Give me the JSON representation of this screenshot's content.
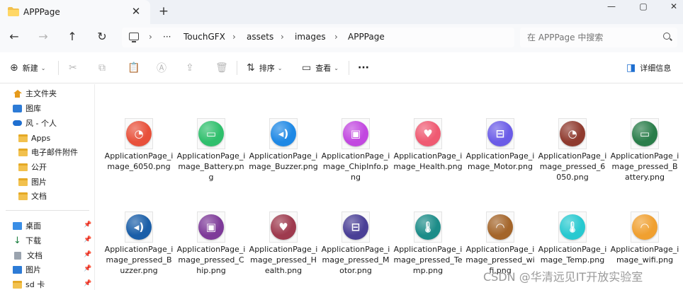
{
  "tab": {
    "title": "APPPage",
    "close": "✕",
    "new": "+"
  },
  "window": {
    "minimize": "—",
    "maximize": "▢",
    "close": "✕"
  },
  "nav": {
    "back": "←",
    "forward": "→",
    "up": "↑",
    "refresh": "↻"
  },
  "breadcrumb": {
    "more": "···",
    "items": [
      "TouchGFX",
      "assets",
      "images",
      "APPPage"
    ],
    "sep": "›"
  },
  "search": {
    "placeholder": "在 APPPage 中搜索"
  },
  "toolbar": {
    "new_label": "新建",
    "new_icon": "⊕",
    "cut_icon": "✂",
    "copy_icon": "⧉",
    "paste_icon": "📋",
    "rename_icon": "Ⓐ",
    "share_icon": "⇪",
    "delete_icon": "🗑",
    "sort_label": "排序",
    "sort_icon": "⇅",
    "view_label": "查看",
    "view_icon": "▭",
    "more": "···",
    "details_label": "详细信息",
    "details_icon": "◨",
    "caret": "⌄"
  },
  "sidebar": {
    "items": [
      {
        "label": "主文件夹",
        "icon": "home-icon"
      },
      {
        "label": "图库",
        "icon": "gallery-icon"
      },
      {
        "label": "风 - 个人",
        "icon": "onedrive-icon"
      },
      {
        "label": "Apps",
        "icon": "folder-icon"
      },
      {
        "label": "电子邮件附件",
        "icon": "folder-icon"
      },
      {
        "label": "公开",
        "icon": "folder-icon"
      },
      {
        "label": "图片",
        "icon": "folder-icon"
      },
      {
        "label": "文档",
        "icon": "folder-icon"
      }
    ],
    "pinned": [
      {
        "label": "桌面",
        "icon": "desktop-icon"
      },
      {
        "label": "下载",
        "icon": "download-icon"
      },
      {
        "label": "文档",
        "icon": "document-icon"
      },
      {
        "label": "图片",
        "icon": "pictures-icon"
      },
      {
        "label": "sd 卡",
        "icon": "drive-icon"
      }
    ],
    "pin_glyph": "📌"
  },
  "files": [
    {
      "name": "ApplicationPage_image_6050.png",
      "color": "#e8503a",
      "glyph": "◔"
    },
    {
      "name": "ApplicationPage_image_Battery.png",
      "color": "#2fbf6c",
      "glyph": "▭"
    },
    {
      "name": "ApplicationPage_image_Buzzer.png",
      "color": "#1e88e5",
      "glyph": "◂)"
    },
    {
      "name": "ApplicationPage_image_ChipInfo.png",
      "color": "#c248e0",
      "glyph": "▣"
    },
    {
      "name": "ApplicationPage_image_Health.png",
      "color": "#ef5a72",
      "glyph": "♥"
    },
    {
      "name": "ApplicationPage_image_Motor.png",
      "color": "#6b5ce7",
      "glyph": "⊟"
    },
    {
      "name": "ApplicationPage_image_pressed_6050.png",
      "color": "#8f3a2e",
      "glyph": "◔"
    },
    {
      "name": "ApplicationPage_image_pressed_Battery.png",
      "color": "#2a7d4a",
      "glyph": "▭"
    },
    {
      "name": "ApplicationPage_image_pressed_Buzzer.png",
      "color": "#1a5ea8",
      "glyph": "◂)"
    },
    {
      "name": "ApplicationPage_image_pressed_Chip.png",
      "color": "#7e3a99",
      "glyph": "▣"
    },
    {
      "name": "ApplicationPage_image_pressed_Health.png",
      "color": "#9e3a4e",
      "glyph": "♥"
    },
    {
      "name": "ApplicationPage_image_pressed_Motor.png",
      "color": "#4a3f96",
      "glyph": "⊟"
    },
    {
      "name": "ApplicationPage_image_pressed_Temp.png",
      "color": "#1c8c88",
      "glyph": "🌡"
    },
    {
      "name": "ApplicationPage_image_pressed_wifi.png",
      "color": "#a4652a",
      "glyph": "◠"
    },
    {
      "name": "ApplicationPage_image_Temp.png",
      "color": "#27c9d0",
      "glyph": "🌡"
    },
    {
      "name": "ApplicationPage_image_wifi.png",
      "color": "#f0a030",
      "glyph": "◠"
    }
  ],
  "watermark": "CSDN @华清远见IT开放实验室"
}
